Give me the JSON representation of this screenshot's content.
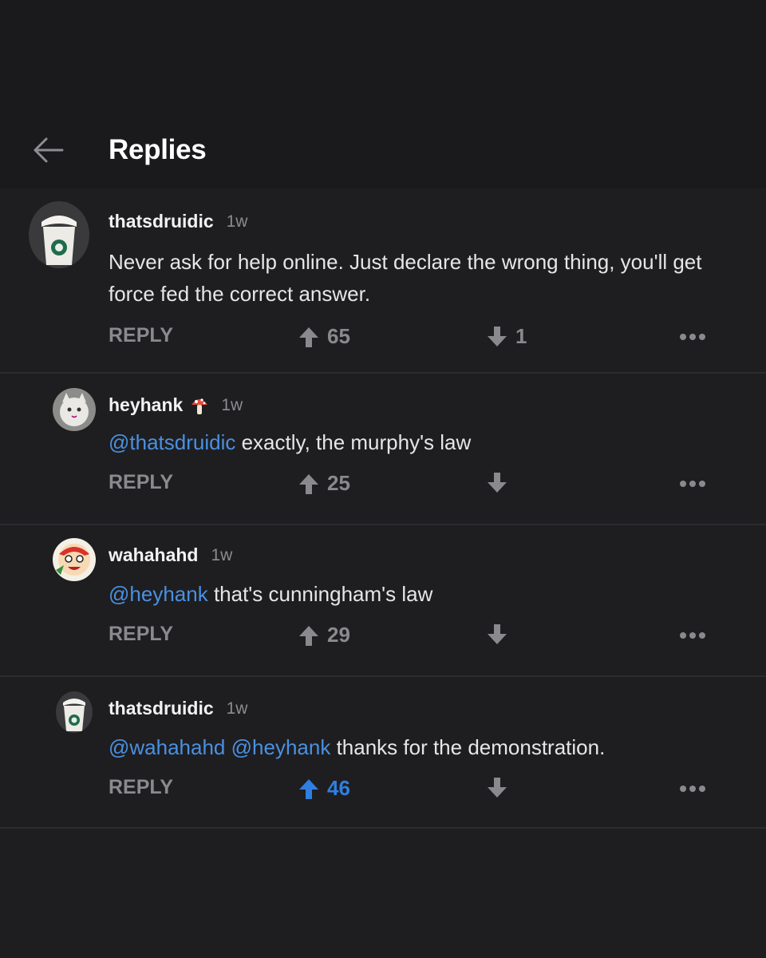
{
  "header": {
    "title": "Replies",
    "back_icon": "arrow-left-icon"
  },
  "colors": {
    "background": "#1e1e20",
    "header_background": "#1a1a1c",
    "text": "#e6e6e8",
    "muted": "#8a8a8e",
    "mention": "#4a90e2",
    "upvote_active": "#2f7fe0"
  },
  "comments": [
    {
      "username": "thatsdruidic",
      "time": "1w",
      "text": "Never ask for help online. Just declare the wrong thing, you'll get force fed the correct answer.",
      "mentions": [],
      "reply_label": "REPLY",
      "upvotes": "65",
      "downvotes": "1",
      "upvoted": false,
      "avatar_icon": "coffee-cup-avatar-icon"
    },
    {
      "username": "heyhank",
      "flair_icon": "mushroom-icon",
      "time": "1w",
      "text": "exactly, the murphy's law",
      "mentions": [
        "@thatsdruidic"
      ],
      "reply_label": "REPLY",
      "upvotes": "25",
      "downvotes": "",
      "upvoted": false,
      "avatar_icon": "cat-avatar-icon"
    },
    {
      "username": "wahahahd",
      "time": "1w",
      "text": "that's cunningham's law",
      "mentions": [
        "@heyhank"
      ],
      "reply_label": "REPLY",
      "upvotes": "29",
      "downvotes": "",
      "upvoted": false,
      "avatar_icon": "cartoon-character-avatar-icon"
    },
    {
      "username": "thatsdruidic",
      "time": "1w",
      "text": "thanks for the demonstration.",
      "mentions": [
        "@wahahahd",
        "@heyhank"
      ],
      "reply_label": "REPLY",
      "upvotes": "46",
      "downvotes": "",
      "upvoted": true,
      "avatar_icon": "coffee-cup-avatar-icon"
    }
  ]
}
